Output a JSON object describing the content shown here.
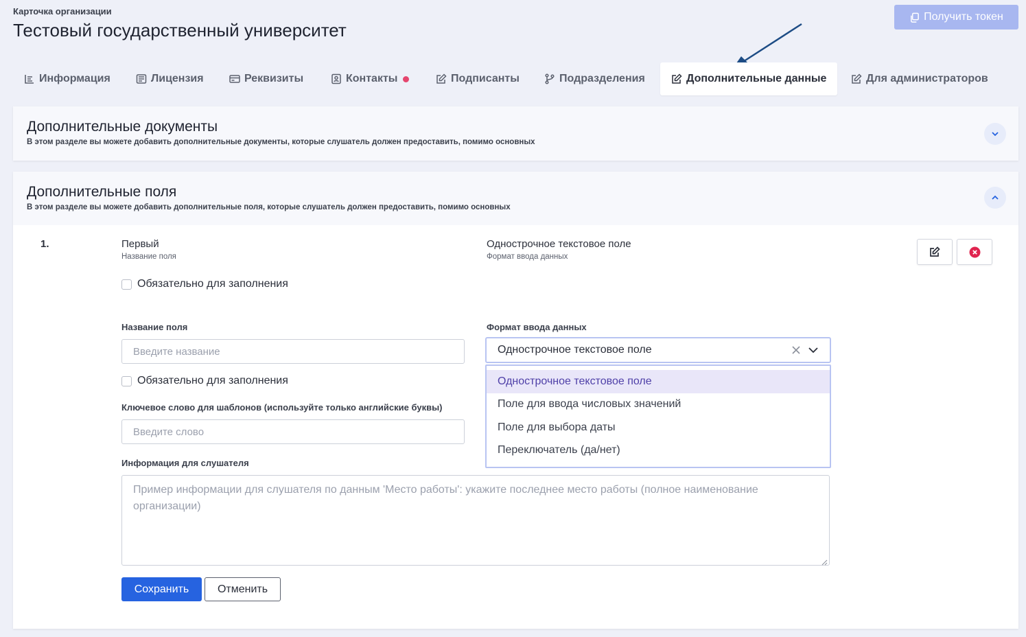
{
  "header": {
    "subtitle": "Карточка организации",
    "title": "Тестовый государственный университет",
    "token_button": "Получить токен"
  },
  "tabs": [
    {
      "label": "Информация",
      "icon": "list-icon"
    },
    {
      "label": "Лицензия",
      "icon": "license-icon"
    },
    {
      "label": "Реквизиты",
      "icon": "card-icon"
    },
    {
      "label": "Контакты",
      "icon": "contact-icon",
      "badge_color": "#e5456e"
    },
    {
      "label": "Подписанты",
      "icon": "edit-icon"
    },
    {
      "label": "Подразделения",
      "icon": "branch-icon"
    },
    {
      "label": "Дополнительные данные",
      "icon": "edit-icon",
      "active": true
    },
    {
      "label": "Для администраторов",
      "icon": "edit-icon"
    }
  ],
  "docs_section": {
    "title": "Дополнительные документы",
    "description": "В этом разделе вы можете добавить дополнительные документы, которые слушатель должен предоставить, помимо основных"
  },
  "fields_section": {
    "title": "Дополнительные поля",
    "description": "В этом разделе вы можете добавить дополнительные поля, которые слушатель должен предоставить, помимо основных",
    "item": {
      "number": "1.",
      "name": "Первый",
      "name_caption": "Название поля",
      "format": "Однострочное текстовое поле",
      "format_caption": "Формат ввода данных",
      "required_label": "Обязательно для заполнения"
    },
    "form": {
      "name_label": "Название поля",
      "name_placeholder": "Введите название",
      "required_label": "Обязательно для заполнения",
      "keyword_label": "Ключевое слово для шаблонов (используйте только английские буквы)",
      "keyword_placeholder": "Введите слово",
      "format_label": "Формат ввода данных",
      "format_value": "Однострочное текстовое поле",
      "format_options": [
        "Однострочное текстовое поле",
        "Поле для ввода числовых значений",
        "Поле для выбора даты",
        "Переключатель (да/нет)"
      ],
      "info_label": "Информация для слушателя",
      "info_placeholder": "Пример информации для слушателя по данным 'Место работы': укажите последнее место работы (полное наименование организации)",
      "save_button": "Сохранить",
      "cancel_button": "Отменить"
    }
  },
  "colors": {
    "primary": "#2663e0",
    "token_button": "#a8b7f0",
    "selected_option_bg": "#e9e6f9",
    "delete_icon": "#e0244f"
  }
}
